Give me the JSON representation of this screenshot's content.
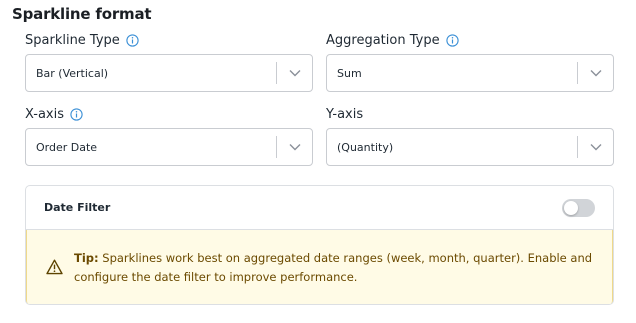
{
  "section": {
    "title": "Sparkline format"
  },
  "fields": {
    "sparkline_type": {
      "label": "Sparkline Type",
      "value": "Bar (Vertical)"
    },
    "aggregation_type": {
      "label": "Aggregation Type",
      "value": "Sum"
    },
    "x_axis": {
      "label": "X-axis",
      "value": "Order Date"
    },
    "y_axis": {
      "label": "Y-axis",
      "value": "(Quantity)"
    }
  },
  "date_filter": {
    "label": "Date Filter",
    "enabled": false,
    "tip_prefix": "Tip:",
    "tip_text": " Sparklines work best on aggregated date ranges (week, month, quarter). Enable and configure the date filter to improve performance."
  },
  "colors": {
    "info_icon": "#3a8fd6",
    "tip_background": "#fffbe6",
    "tip_border": "#efd98a",
    "tip_text": "#6b4a00",
    "toggle_off": "#d1d4d8"
  },
  "icons": {
    "info": "info-icon",
    "chevron": "chevron-down-icon",
    "warning": "warning-icon"
  }
}
